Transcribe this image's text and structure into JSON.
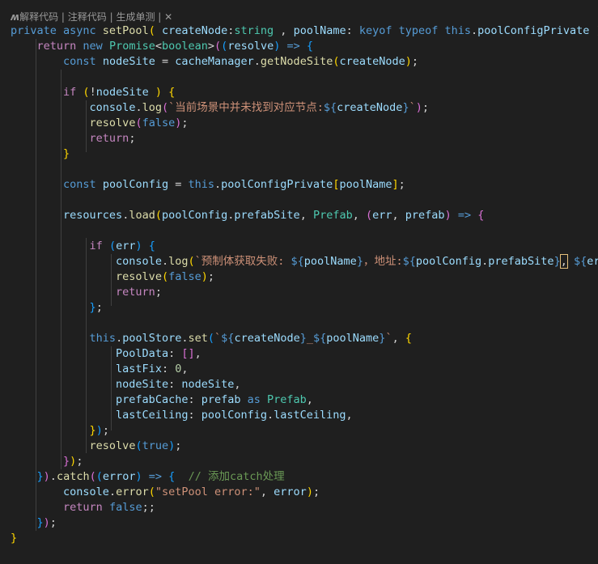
{
  "codelens": {
    "explain": "解释代码",
    "comment": "注释代码",
    "unit_test": "生成单测",
    "sep": " | ",
    "close": "✕"
  },
  "colors": {
    "background": "#1f1f1f",
    "keyword": "#569cd6",
    "control": "#c586c0",
    "function": "#dcdcaa",
    "variable": "#9cdcfe",
    "type": "#4ec9b0",
    "string": "#ce9178",
    "number": "#b5cea8",
    "comment": "#6a9955"
  },
  "code_lines": [
    [
      [
        "k",
        "private async "
      ],
      [
        "f",
        "setPool"
      ],
      [
        "b1",
        "( "
      ],
      [
        "v",
        "createNode"
      ],
      [
        "p",
        ":"
      ],
      [
        "t",
        "string"
      ],
      [
        "p",
        " , "
      ],
      [
        "v",
        "poolName"
      ],
      [
        "p",
        ": "
      ],
      [
        "k",
        "keyof typeof this"
      ],
      [
        "p",
        "."
      ],
      [
        "v",
        "poolConfigPrivate"
      ],
      [
        "b1",
        " ) "
      ],
      [
        "b1",
        "{"
      ]
    ],
    [
      [
        "p",
        "    "
      ],
      [
        "c",
        "return "
      ],
      [
        "k",
        "new "
      ],
      [
        "t",
        "Promise"
      ],
      [
        "p",
        "<"
      ],
      [
        "t",
        "boolean"
      ],
      [
        "p",
        ">"
      ],
      [
        "b2",
        "("
      ],
      [
        "b3",
        "("
      ],
      [
        "v",
        "resolve"
      ],
      [
        "b3",
        ")"
      ],
      [
        "k",
        " => "
      ],
      [
        "b3",
        "{"
      ]
    ],
    [
      [
        "p",
        "        "
      ],
      [
        "k",
        "const "
      ],
      [
        "v",
        "nodeSite"
      ],
      [
        "p",
        " = "
      ],
      [
        "v",
        "cacheManager"
      ],
      [
        "p",
        "."
      ],
      [
        "f",
        "getNodeSite"
      ],
      [
        "b1",
        "("
      ],
      [
        "v",
        "createNode"
      ],
      [
        "b1",
        ")"
      ],
      [
        "p",
        ";"
      ]
    ],
    [],
    [
      [
        "p",
        "        "
      ],
      [
        "c",
        "if "
      ],
      [
        "b1",
        "("
      ],
      [
        "p",
        "!"
      ],
      [
        "v",
        "nodeSite"
      ],
      [
        "b1",
        " ) "
      ],
      [
        "b1",
        "{"
      ]
    ],
    [
      [
        "p",
        "            "
      ],
      [
        "v",
        "console"
      ],
      [
        "p",
        "."
      ],
      [
        "f",
        "log"
      ],
      [
        "b2",
        "("
      ],
      [
        "s",
        "`当前场景中并未找到对应节点:"
      ],
      [
        "k",
        "${"
      ],
      [
        "v",
        "createNode"
      ],
      [
        "k",
        "}"
      ],
      [
        "s",
        "`"
      ],
      [
        "b2",
        ")"
      ],
      [
        "p",
        ";"
      ]
    ],
    [
      [
        "p",
        "            "
      ],
      [
        "f",
        "resolve"
      ],
      [
        "b2",
        "("
      ],
      [
        "k",
        "false"
      ],
      [
        "b2",
        ")"
      ],
      [
        "p",
        ";"
      ]
    ],
    [
      [
        "p",
        "            "
      ],
      [
        "c",
        "return"
      ],
      [
        "p",
        ";"
      ]
    ],
    [
      [
        "p",
        "        "
      ],
      [
        "b1",
        "}"
      ]
    ],
    [],
    [
      [
        "p",
        "        "
      ],
      [
        "k",
        "const "
      ],
      [
        "v",
        "poolConfig"
      ],
      [
        "p",
        " = "
      ],
      [
        "k",
        "this"
      ],
      [
        "p",
        "."
      ],
      [
        "v",
        "poolConfigPrivate"
      ],
      [
        "b1",
        "["
      ],
      [
        "v",
        "poolName"
      ],
      [
        "b1",
        "]"
      ],
      [
        "p",
        ";"
      ]
    ],
    [],
    [
      [
        "p",
        "        "
      ],
      [
        "v",
        "resources"
      ],
      [
        "p",
        "."
      ],
      [
        "f",
        "load"
      ],
      [
        "b1",
        "("
      ],
      [
        "v",
        "poolConfig"
      ],
      [
        "p",
        "."
      ],
      [
        "v",
        "prefabSite"
      ],
      [
        "p",
        ", "
      ],
      [
        "t",
        "Prefab"
      ],
      [
        "p",
        ", "
      ],
      [
        "b2",
        "("
      ],
      [
        "v",
        "err"
      ],
      [
        "p",
        ", "
      ],
      [
        "v",
        "prefab"
      ],
      [
        "b2",
        ")"
      ],
      [
        "k",
        " => "
      ],
      [
        "b2",
        "{"
      ]
    ],
    [],
    [
      [
        "p",
        "            "
      ],
      [
        "c",
        "if "
      ],
      [
        "b3",
        "("
      ],
      [
        "v",
        "err"
      ],
      [
        "b3",
        ") "
      ],
      [
        "b3",
        "{"
      ]
    ],
    [
      [
        "p",
        "                "
      ],
      [
        "v",
        "console"
      ],
      [
        "p",
        "."
      ],
      [
        "f",
        "log"
      ],
      [
        "b1",
        "("
      ],
      [
        "s",
        "`预制体获取失败: "
      ],
      [
        "k",
        "${"
      ],
      [
        "v",
        "poolName"
      ],
      [
        "k",
        "}"
      ],
      [
        "s",
        "，地址:"
      ],
      [
        "k",
        "${"
      ],
      [
        "v",
        "poolConfig"
      ],
      [
        "p",
        "."
      ],
      [
        "v",
        "prefabSite"
      ],
      [
        "k",
        "}"
      ],
      [
        "hl",
        ","
      ],
      [
        "s",
        " "
      ],
      [
        "k",
        "${"
      ],
      [
        "v",
        "err"
      ],
      [
        "k",
        "}"
      ],
      [
        "s",
        "`"
      ],
      [
        "b1",
        ")"
      ]
    ],
    [
      [
        "p",
        "                "
      ],
      [
        "f",
        "resolve"
      ],
      [
        "b1",
        "("
      ],
      [
        "k",
        "false"
      ],
      [
        "b1",
        ")"
      ],
      [
        "p",
        ";"
      ]
    ],
    [
      [
        "p",
        "                "
      ],
      [
        "c",
        "return"
      ],
      [
        "p",
        ";"
      ]
    ],
    [
      [
        "p",
        "            "
      ],
      [
        "b3",
        "}"
      ],
      [
        "p",
        ";"
      ]
    ],
    [],
    [
      [
        "p",
        "            "
      ],
      [
        "k",
        "this"
      ],
      [
        "p",
        "."
      ],
      [
        "v",
        "poolStore"
      ],
      [
        "p",
        "."
      ],
      [
        "f",
        "set"
      ],
      [
        "b3",
        "("
      ],
      [
        "s",
        "`"
      ],
      [
        "k",
        "${"
      ],
      [
        "v",
        "createNode"
      ],
      [
        "k",
        "}"
      ],
      [
        "s",
        "_"
      ],
      [
        "k",
        "${"
      ],
      [
        "v",
        "poolName"
      ],
      [
        "k",
        "}"
      ],
      [
        "s",
        "`"
      ],
      [
        "p",
        ", "
      ],
      [
        "b1",
        "{"
      ]
    ],
    [
      [
        "p",
        "                "
      ],
      [
        "v",
        "PoolData"
      ],
      [
        "p",
        ": "
      ],
      [
        "b2",
        "[]"
      ],
      [
        "p",
        ","
      ]
    ],
    [
      [
        "p",
        "                "
      ],
      [
        "v",
        "lastFix"
      ],
      [
        "p",
        ": "
      ],
      [
        "n",
        "0"
      ],
      [
        "p",
        ","
      ]
    ],
    [
      [
        "p",
        "                "
      ],
      [
        "v",
        "nodeSite"
      ],
      [
        "p",
        ": "
      ],
      [
        "v",
        "nodeSite"
      ],
      [
        "p",
        ","
      ]
    ],
    [
      [
        "p",
        "                "
      ],
      [
        "v",
        "prefabCache"
      ],
      [
        "p",
        ": "
      ],
      [
        "v",
        "prefab"
      ],
      [
        "k",
        " as "
      ],
      [
        "t",
        "Prefab"
      ],
      [
        "p",
        ","
      ]
    ],
    [
      [
        "p",
        "                "
      ],
      [
        "v",
        "lastCeiling"
      ],
      [
        "p",
        ": "
      ],
      [
        "v",
        "poolConfig"
      ],
      [
        "p",
        "."
      ],
      [
        "v",
        "lastCeiling"
      ],
      [
        "p",
        ","
      ]
    ],
    [
      [
        "p",
        "            "
      ],
      [
        "b1",
        "}"
      ],
      [
        "b3",
        ")"
      ],
      [
        "p",
        ";"
      ]
    ],
    [
      [
        "p",
        "            "
      ],
      [
        "f",
        "resolve"
      ],
      [
        "b3",
        "("
      ],
      [
        "k",
        "true"
      ],
      [
        "b3",
        ")"
      ],
      [
        "p",
        ";"
      ]
    ],
    [
      [
        "p",
        "        "
      ],
      [
        "b2",
        "}"
      ],
      [
        "b1",
        ")"
      ],
      [
        "p",
        ";"
      ]
    ],
    [
      [
        "p",
        "    "
      ],
      [
        "b3",
        "}"
      ],
      [
        "b2",
        ")"
      ],
      [
        "p",
        "."
      ],
      [
        "f",
        "catch"
      ],
      [
        "b2",
        "("
      ],
      [
        "b3",
        "("
      ],
      [
        "v",
        "error"
      ],
      [
        "b3",
        ")"
      ],
      [
        "k",
        " => "
      ],
      [
        "b3",
        "{"
      ],
      [
        "p",
        "  "
      ],
      [
        "cm",
        "// 添加catch处理"
      ]
    ],
    [
      [
        "p",
        "        "
      ],
      [
        "v",
        "console"
      ],
      [
        "p",
        "."
      ],
      [
        "f",
        "error"
      ],
      [
        "b1",
        "("
      ],
      [
        "s",
        "\"setPool error:\""
      ],
      [
        "p",
        ", "
      ],
      [
        "v",
        "error"
      ],
      [
        "b1",
        ")"
      ],
      [
        "p",
        ";"
      ]
    ],
    [
      [
        "p",
        "        "
      ],
      [
        "c",
        "return "
      ],
      [
        "k",
        "false"
      ],
      [
        "p",
        ";;"
      ]
    ],
    [
      [
        "p",
        "    "
      ],
      [
        "b3",
        "}"
      ],
      [
        "b2",
        ")"
      ],
      [
        "p",
        ";"
      ]
    ],
    [
      [
        "b1",
        "}"
      ]
    ]
  ]
}
